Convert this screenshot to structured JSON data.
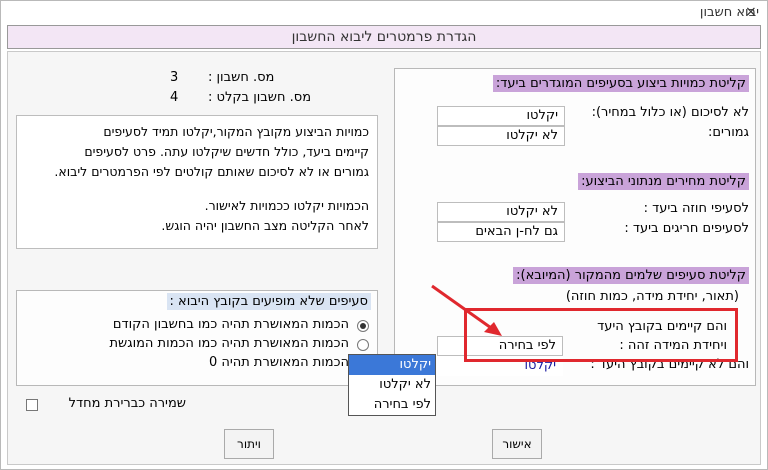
{
  "window": {
    "title": "יבוא חשבון",
    "close": "×"
  },
  "header": {
    "title": "הגדרת פרמטרים ליבוא החשבון"
  },
  "top_info": {
    "account_no_label": "מס. חשבון :",
    "account_no_value": "3",
    "input_account_label": "מס. חשבון בקלט :",
    "input_account_value": "4"
  },
  "info_text": {
    "line1": "כמויות הביצוע מקובץ המקור,יקלטו תמיד לסעיפים",
    "line2": "קיימים ביעד, כולל חדשים שיקלטו עתה. פרט לסעיפים",
    "line3": "גמורים או לא לסיכום שאותם קולטים לפי הפרמטרים ליבוא.",
    "line4": "הכמויות יקלטו ככמויות לאישור.",
    "line5": "לאחר הקליטה מצב החשבון יהיה הוגש."
  },
  "missing_section": {
    "title": "סעיפים שלא מופיעים בקובץ היבוא :",
    "option1": "הכמות המאושרת תהיה כמו בחשבון הקודם",
    "option2": "הכמות המאושרת תהיה כמו הכמות המוגשת",
    "option3": "הכמות המאושרת תהיה 0"
  },
  "save_default": "שמירה כברירת מחדל",
  "right_panel": {
    "sec1_title": "קליטת כמויות ביצוע בסעיפים המוגדרים ביעד:",
    "sec1_row1_label": "לא לסיכום (או כלול במחיר):",
    "sec1_row1_value": "יקלטו",
    "sec1_row2_label": "גמורים:",
    "sec1_row2_value": "לא יקלטו",
    "sec2_title": "קליטת מחירים מנתוני הביצוע:",
    "sec2_row1_label": "לסעיפי חוזה ביעד :",
    "sec2_row1_value": "לא יקלטו",
    "sec2_row2_label": "לסעיפים חריגים ביעד :",
    "sec2_row2_value": "גם לח-ן הבאים",
    "sec3_title": "קליטת סעיפים שלמים מהמקור (המיובא):",
    "sec3_sub": "(תאור, יחידת מידה, כמות חוזה)",
    "sec3_row1_label": "והם קיימים בקובץ היעד",
    "sec3_row2_label": "ויחידת המידה זהה :",
    "sec3_row2_value": "לפי בחירה",
    "sec3_row3_label": "והם לא קיימים בקובץ היעד :",
    "sec3_row3_value": "יקלטו"
  },
  "dropdown": {
    "options": [
      "יקלטו",
      "לא יקלטו",
      "לפי בחירה"
    ],
    "selected": "יקלטו"
  },
  "buttons": {
    "cancel": "ויתור",
    "ok": "אישור"
  }
}
